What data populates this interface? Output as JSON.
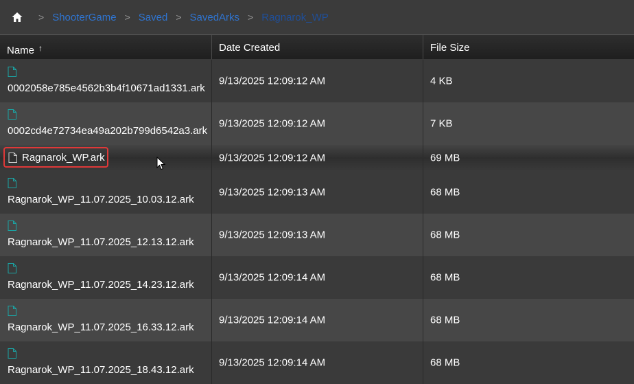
{
  "breadcrumb": {
    "items": [
      "ShooterGame",
      "Saved",
      "SavedArks",
      "Ragnarok_WP"
    ],
    "separator": ">"
  },
  "table": {
    "columns": {
      "name": "Name",
      "date": "Date Created",
      "size": "File Size",
      "sort_indicator": "↑"
    },
    "rows": [
      {
        "name": "0002058e785e4562b3b4f10671ad1331.ark",
        "date": "9/13/2025 12:09:12 AM",
        "size": "4 KB"
      },
      {
        "name": "0002cd4e72734ea49a202b799d6542a3.ark",
        "date": "9/13/2025 12:09:12 AM",
        "size": "7 KB"
      },
      {
        "name": "Ragnarok_WP.ark",
        "date": "9/13/2025 12:09:12 AM",
        "size": "69 MB",
        "selected": true
      },
      {
        "name": "Ragnarok_WP_11.07.2025_10.03.12.ark",
        "date": "9/13/2025 12:09:13 AM",
        "size": "68 MB"
      },
      {
        "name": "Ragnarok_WP_11.07.2025_12.13.12.ark",
        "date": "9/13/2025 12:09:13 AM",
        "size": "68 MB"
      },
      {
        "name": "Ragnarok_WP_11.07.2025_14.23.12.ark",
        "date": "9/13/2025 12:09:14 AM",
        "size": "68 MB"
      },
      {
        "name": "Ragnarok_WP_11.07.2025_16.33.12.ark",
        "date": "9/13/2025 12:09:14 AM",
        "size": "68 MB"
      },
      {
        "name": "Ragnarok_WP_11.07.2025_18.43.12.ark",
        "date": "9/13/2025 12:09:14 AM",
        "size": "68 MB"
      }
    ]
  },
  "colors": {
    "link": "#2f74d0",
    "current_crumb": "#1f4f9a",
    "file_icon": "#1aa6a6",
    "selection_border": "#e03838"
  },
  "icons": {
    "home": "home-icon",
    "file": "file-icon",
    "cursor": "mouse-pointer-icon"
  }
}
